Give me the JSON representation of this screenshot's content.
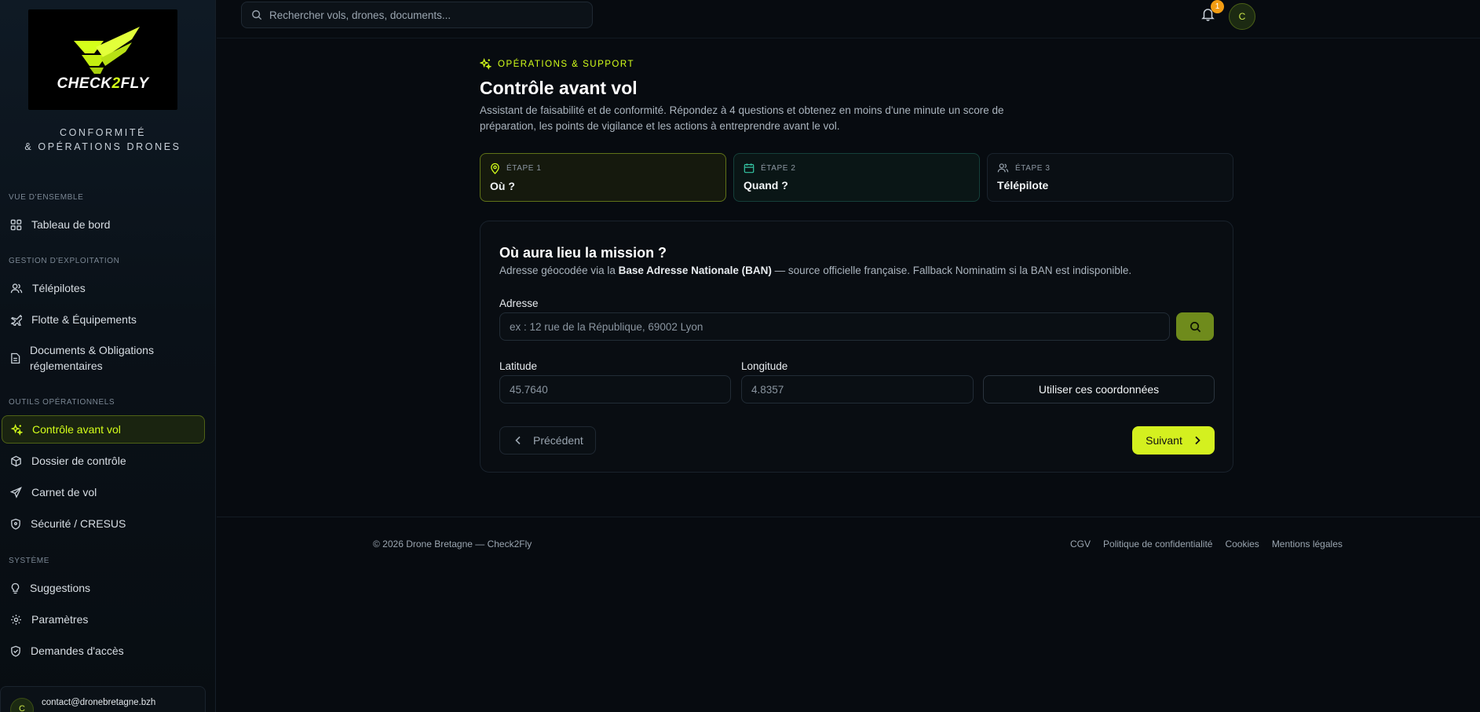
{
  "brand": {
    "logo_word_a": "CHECK",
    "logo_word_b": "2",
    "logo_word_c": "FLY",
    "subtitle_line1": "CONFORMITÉ",
    "subtitle_line2": "& OPÉRATIONS DRONES",
    "accent": "#d4ff1a"
  },
  "sidebar": {
    "sections": [
      {
        "title": "VUE D'ENSEMBLE"
      },
      {
        "title": "GESTION D'EXPLOITATION"
      },
      {
        "title": "OUTILS OPÉRATIONNELS"
      },
      {
        "title": "SYSTÈME"
      }
    ],
    "items": [
      {
        "label": "Tableau de bord",
        "icon": "grid-icon"
      },
      {
        "label": "Télépilotes",
        "icon": "users-icon"
      },
      {
        "label": "Flotte & Équipements",
        "icon": "plane-icon"
      },
      {
        "label": "Documents & Obligations réglementaires",
        "icon": "document-icon"
      },
      {
        "label": "Contrôle avant vol",
        "icon": "sparkle-icon",
        "active": true
      },
      {
        "label": "Dossier de contrôle",
        "icon": "box-icon"
      },
      {
        "label": "Carnet de vol",
        "icon": "send-icon"
      },
      {
        "label": "Sécurité / CRESUS",
        "icon": "shield-icon"
      },
      {
        "label": "Suggestions",
        "icon": "lightbulb-icon"
      },
      {
        "label": "Paramètres",
        "icon": "gear-icon"
      },
      {
        "label": "Demandes d'accès",
        "icon": "shield-check-icon"
      }
    ],
    "user": {
      "initial": "C",
      "email": "contact@dronebretagne.bzh"
    }
  },
  "topbar": {
    "search_placeholder": "Rechercher vols, drones, documents...",
    "notification_count": "1",
    "avatar_initial": "C"
  },
  "main": {
    "eyebrow": "OPÉRATIONS & SUPPORT",
    "title": "Contrôle avant vol",
    "description": "Assistant de faisabilité et de conformité. Répondez à 4 questions et obtenez en moins d'une minute un score de préparation, les points de vigilance et les actions à entreprendre avant le vol.",
    "steps": [
      {
        "kicker": "ÉTAPE 1",
        "label": "Où ?",
        "icon": "map-pin-icon"
      },
      {
        "kicker": "ÉTAPE 2",
        "label": "Quand ?",
        "icon": "calendar-icon"
      },
      {
        "kicker": "ÉTAPE 3",
        "label": "Télépilote",
        "icon": "users-icon"
      }
    ],
    "card": {
      "title": "Où aura lieu la mission ?",
      "subtitle_pre": "Adresse géocodée via la ",
      "subtitle_bold": "Base Adresse Nationale (BAN)",
      "subtitle_post": " — source officielle française. Fallback Nominatim si la BAN est indisponible.",
      "address_label": "Adresse",
      "address_placeholder": "ex : 12 rue de la République, 69002 Lyon",
      "address_value": "",
      "latitude_label": "Latitude",
      "latitude_placeholder": "45.7640",
      "longitude_label": "Longitude",
      "longitude_placeholder": "4.8357",
      "use_coords_label": "Utiliser ces coordonnées",
      "prev_label": "Précédent",
      "next_label": "Suivant"
    }
  },
  "footer": {
    "copyright": "© 2026 Drone Bretagne — Check2Fly",
    "links": [
      "CGV",
      "Politique de confidentialité",
      "Cookies",
      "Mentions légales"
    ]
  }
}
